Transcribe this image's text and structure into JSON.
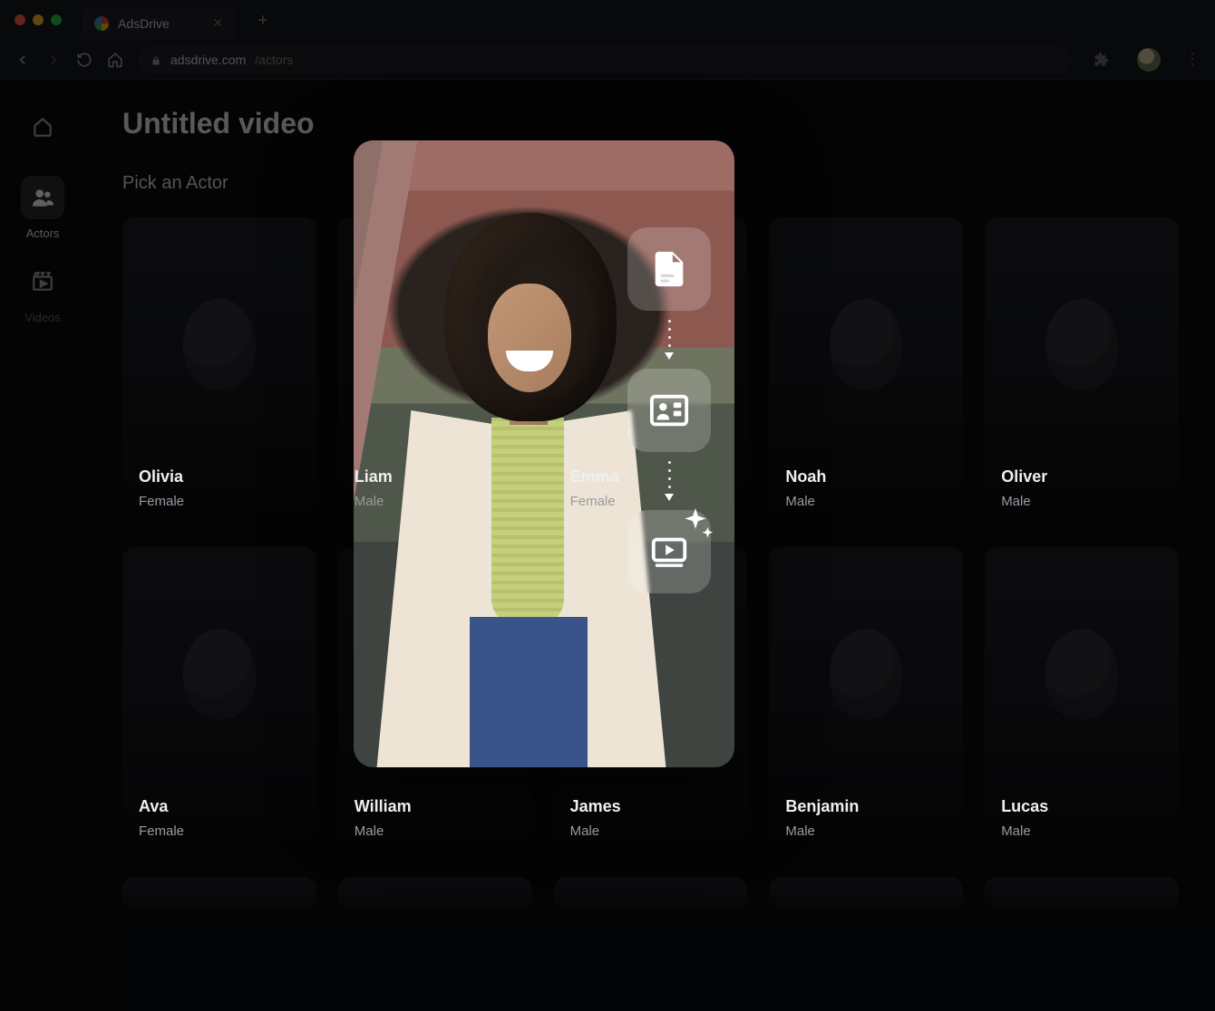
{
  "browser": {
    "tab_title": "AdsDrive",
    "url_host": "adsdrive.com",
    "url_path": "/actors"
  },
  "sidebar": {
    "items": [
      {
        "label": "",
        "icon": "home"
      },
      {
        "label": "Actors",
        "icon": "people"
      },
      {
        "label": "Videos",
        "icon": "video"
      }
    ]
  },
  "page": {
    "title": "Untitled video",
    "subtitle": "Pick an Actor"
  },
  "actors": [
    {
      "name": "Olivia",
      "gender": "Female"
    },
    {
      "name": "Liam",
      "gender": "Male"
    },
    {
      "name": "Emma",
      "gender": "Female"
    },
    {
      "name": "Noah",
      "gender": "Male"
    },
    {
      "name": "Oliver",
      "gender": "Male"
    },
    {
      "name": "Ava",
      "gender": "Female"
    },
    {
      "name": "William",
      "gender": "Male"
    },
    {
      "name": "James",
      "gender": "Male"
    },
    {
      "name": "Benjamin",
      "gender": "Male"
    },
    {
      "name": "Lucas",
      "gender": "Male"
    }
  ],
  "modal": {
    "steps": [
      "document",
      "contact-card",
      "video-ai"
    ]
  }
}
